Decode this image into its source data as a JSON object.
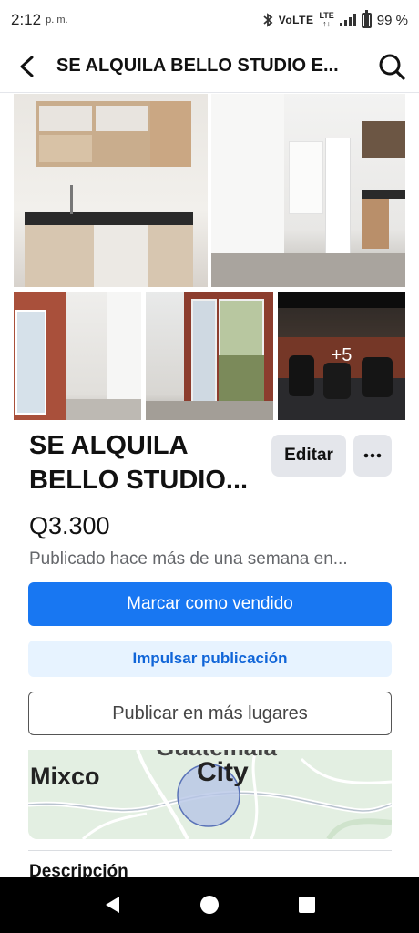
{
  "status_bar": {
    "time": "2:12",
    "ampm": "p. m.",
    "volte": "VoLTE",
    "lte": "LTE",
    "battery": "99 %"
  },
  "header": {
    "title": "SE ALQUILA BELLO STUDIO E...",
    "back_icon": "back-arrow-icon",
    "search_icon": "search-icon"
  },
  "gallery": {
    "more_count": "+5"
  },
  "listing": {
    "title": "SE ALQUILA BELLO STUDIO...",
    "price": "Q3.300",
    "published": "Publicado hace más de una semana en..."
  },
  "actions": {
    "edit_label": "Editar",
    "mark_sold_label": "Marcar como vendido",
    "boost_label": "Impulsar publicación",
    "publish_more_label": "Publicar en más lugares"
  },
  "map": {
    "label_left": "Mixco",
    "label_city": "City",
    "label_top": "Guatemala"
  },
  "description": {
    "heading": "Descripción"
  },
  "colors": {
    "primary": "#1877f2",
    "boost_bg": "#e7f3ff",
    "boost_text": "#1065d8",
    "secondary_bg": "#e4e6eb"
  }
}
